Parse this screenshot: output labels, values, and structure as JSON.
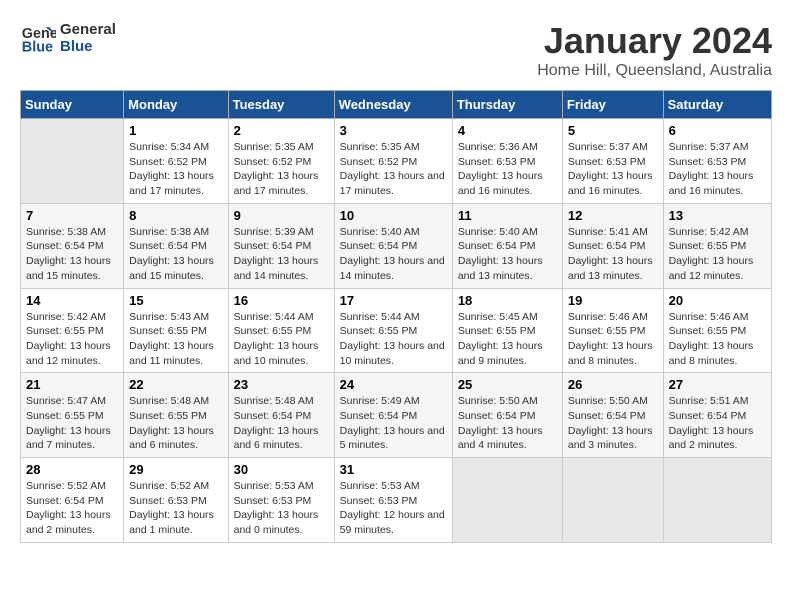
{
  "header": {
    "logo_line1": "General",
    "logo_line2": "Blue",
    "month_year": "January 2024",
    "location": "Home Hill, Queensland, Australia"
  },
  "days_of_week": [
    "Sunday",
    "Monday",
    "Tuesday",
    "Wednesday",
    "Thursday",
    "Friday",
    "Saturday"
  ],
  "weeks": [
    [
      {
        "day": "",
        "sunrise": "",
        "sunset": "",
        "daylight": ""
      },
      {
        "day": "1",
        "sunrise": "Sunrise: 5:34 AM",
        "sunset": "Sunset: 6:52 PM",
        "daylight": "Daylight: 13 hours and 17 minutes."
      },
      {
        "day": "2",
        "sunrise": "Sunrise: 5:35 AM",
        "sunset": "Sunset: 6:52 PM",
        "daylight": "Daylight: 13 hours and 17 minutes."
      },
      {
        "day": "3",
        "sunrise": "Sunrise: 5:35 AM",
        "sunset": "Sunset: 6:52 PM",
        "daylight": "Daylight: 13 hours and 17 minutes."
      },
      {
        "day": "4",
        "sunrise": "Sunrise: 5:36 AM",
        "sunset": "Sunset: 6:53 PM",
        "daylight": "Daylight: 13 hours and 16 minutes."
      },
      {
        "day": "5",
        "sunrise": "Sunrise: 5:37 AM",
        "sunset": "Sunset: 6:53 PM",
        "daylight": "Daylight: 13 hours and 16 minutes."
      },
      {
        "day": "6",
        "sunrise": "Sunrise: 5:37 AM",
        "sunset": "Sunset: 6:53 PM",
        "daylight": "Daylight: 13 hours and 16 minutes."
      }
    ],
    [
      {
        "day": "7",
        "sunrise": "Sunrise: 5:38 AM",
        "sunset": "Sunset: 6:54 PM",
        "daylight": "Daylight: 13 hours and 15 minutes."
      },
      {
        "day": "8",
        "sunrise": "Sunrise: 5:38 AM",
        "sunset": "Sunset: 6:54 PM",
        "daylight": "Daylight: 13 hours and 15 minutes."
      },
      {
        "day": "9",
        "sunrise": "Sunrise: 5:39 AM",
        "sunset": "Sunset: 6:54 PM",
        "daylight": "Daylight: 13 hours and 14 minutes."
      },
      {
        "day": "10",
        "sunrise": "Sunrise: 5:40 AM",
        "sunset": "Sunset: 6:54 PM",
        "daylight": "Daylight: 13 hours and 14 minutes."
      },
      {
        "day": "11",
        "sunrise": "Sunrise: 5:40 AM",
        "sunset": "Sunset: 6:54 PM",
        "daylight": "Daylight: 13 hours and 13 minutes."
      },
      {
        "day": "12",
        "sunrise": "Sunrise: 5:41 AM",
        "sunset": "Sunset: 6:54 PM",
        "daylight": "Daylight: 13 hours and 13 minutes."
      },
      {
        "day": "13",
        "sunrise": "Sunrise: 5:42 AM",
        "sunset": "Sunset: 6:55 PM",
        "daylight": "Daylight: 13 hours and 12 minutes."
      }
    ],
    [
      {
        "day": "14",
        "sunrise": "Sunrise: 5:42 AM",
        "sunset": "Sunset: 6:55 PM",
        "daylight": "Daylight: 13 hours and 12 minutes."
      },
      {
        "day": "15",
        "sunrise": "Sunrise: 5:43 AM",
        "sunset": "Sunset: 6:55 PM",
        "daylight": "Daylight: 13 hours and 11 minutes."
      },
      {
        "day": "16",
        "sunrise": "Sunrise: 5:44 AM",
        "sunset": "Sunset: 6:55 PM",
        "daylight": "Daylight: 13 hours and 10 minutes."
      },
      {
        "day": "17",
        "sunrise": "Sunrise: 5:44 AM",
        "sunset": "Sunset: 6:55 PM",
        "daylight": "Daylight: 13 hours and 10 minutes."
      },
      {
        "day": "18",
        "sunrise": "Sunrise: 5:45 AM",
        "sunset": "Sunset: 6:55 PM",
        "daylight": "Daylight: 13 hours and 9 minutes."
      },
      {
        "day": "19",
        "sunrise": "Sunrise: 5:46 AM",
        "sunset": "Sunset: 6:55 PM",
        "daylight": "Daylight: 13 hours and 8 minutes."
      },
      {
        "day": "20",
        "sunrise": "Sunrise: 5:46 AM",
        "sunset": "Sunset: 6:55 PM",
        "daylight": "Daylight: 13 hours and 8 minutes."
      }
    ],
    [
      {
        "day": "21",
        "sunrise": "Sunrise: 5:47 AM",
        "sunset": "Sunset: 6:55 PM",
        "daylight": "Daylight: 13 hours and 7 minutes."
      },
      {
        "day": "22",
        "sunrise": "Sunrise: 5:48 AM",
        "sunset": "Sunset: 6:55 PM",
        "daylight": "Daylight: 13 hours and 6 minutes."
      },
      {
        "day": "23",
        "sunrise": "Sunrise: 5:48 AM",
        "sunset": "Sunset: 6:54 PM",
        "daylight": "Daylight: 13 hours and 6 minutes."
      },
      {
        "day": "24",
        "sunrise": "Sunrise: 5:49 AM",
        "sunset": "Sunset: 6:54 PM",
        "daylight": "Daylight: 13 hours and 5 minutes."
      },
      {
        "day": "25",
        "sunrise": "Sunrise: 5:50 AM",
        "sunset": "Sunset: 6:54 PM",
        "daylight": "Daylight: 13 hours and 4 minutes."
      },
      {
        "day": "26",
        "sunrise": "Sunrise: 5:50 AM",
        "sunset": "Sunset: 6:54 PM",
        "daylight": "Daylight: 13 hours and 3 minutes."
      },
      {
        "day": "27",
        "sunrise": "Sunrise: 5:51 AM",
        "sunset": "Sunset: 6:54 PM",
        "daylight": "Daylight: 13 hours and 2 minutes."
      }
    ],
    [
      {
        "day": "28",
        "sunrise": "Sunrise: 5:52 AM",
        "sunset": "Sunset: 6:54 PM",
        "daylight": "Daylight: 13 hours and 2 minutes."
      },
      {
        "day": "29",
        "sunrise": "Sunrise: 5:52 AM",
        "sunset": "Sunset: 6:53 PM",
        "daylight": "Daylight: 13 hours and 1 minute."
      },
      {
        "day": "30",
        "sunrise": "Sunrise: 5:53 AM",
        "sunset": "Sunset: 6:53 PM",
        "daylight": "Daylight: 13 hours and 0 minutes."
      },
      {
        "day": "31",
        "sunrise": "Sunrise: 5:53 AM",
        "sunset": "Sunset: 6:53 PM",
        "daylight": "Daylight: 12 hours and 59 minutes."
      },
      {
        "day": "",
        "sunrise": "",
        "sunset": "",
        "daylight": ""
      },
      {
        "day": "",
        "sunrise": "",
        "sunset": "",
        "daylight": ""
      },
      {
        "day": "",
        "sunrise": "",
        "sunset": "",
        "daylight": ""
      }
    ]
  ]
}
